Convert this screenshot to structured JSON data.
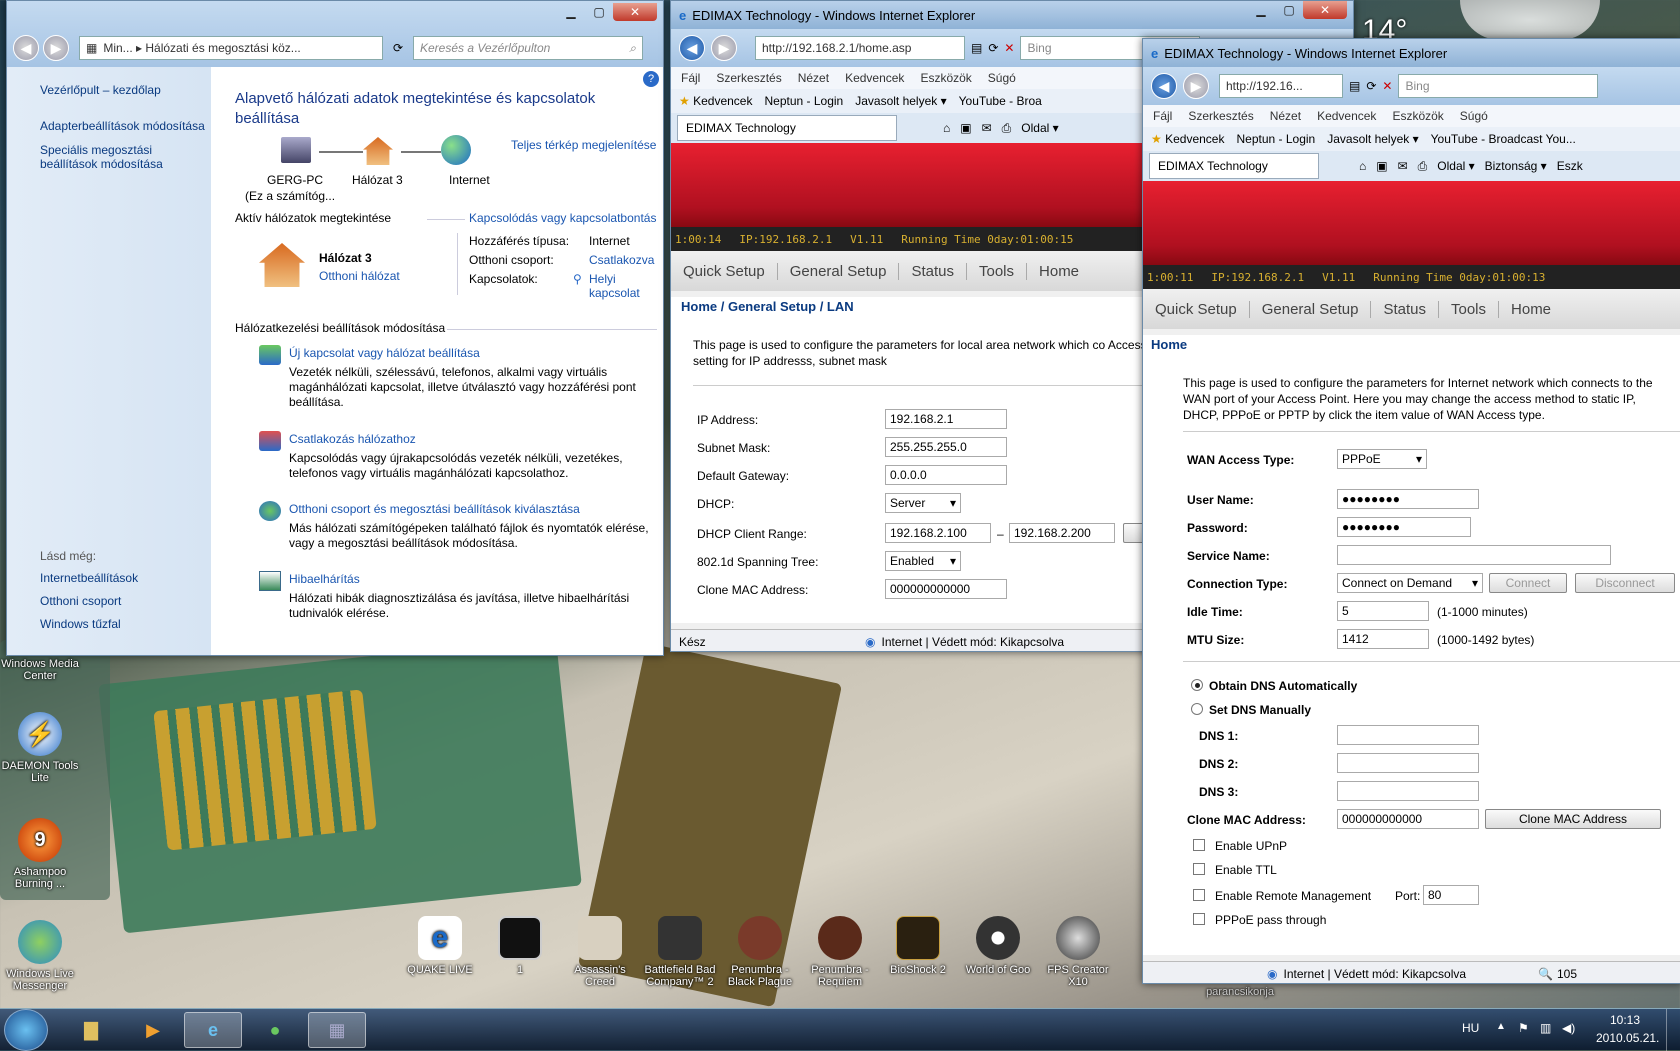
{
  "desktop": {
    "icons": [
      {
        "label": "Windows Media Center"
      },
      {
        "label": "DAEMON Tools Lite"
      },
      {
        "label": "Ashampoo Burning ..."
      },
      {
        "label": "Windows Live Messenger"
      },
      {
        "label": "QUAKE LIVE"
      },
      {
        "label": "1"
      },
      {
        "label": "Assassin's Creed"
      },
      {
        "label": "Battlefield Bad Company™ 2"
      },
      {
        "label": "Penumbra - Black Plague"
      },
      {
        "label": "Penumbra - Requiem"
      },
      {
        "label": "BioShock 2"
      },
      {
        "label": "World of Goo"
      },
      {
        "label": "FPS Creator X10"
      }
    ],
    "overlay_text": "parancsikonja",
    "gadget_temp": "14°"
  },
  "cp": {
    "address": "Min... ▸ Hálózati és megosztási köz...",
    "search_placeholder": "Keresés a Vezérlőpulton",
    "sidebar": {
      "home": "Vezérlőpult – kezdőlap",
      "items": [
        "Adapterbeállítások módosítása",
        "Speciális megosztási beállítások módosítása"
      ],
      "see_also_title": "Lásd még:",
      "see_also": [
        "Internetbeállítások",
        "Otthoni csoport",
        "Windows tűzfal"
      ]
    },
    "title": "Alapvető hálózati adatok megtekintése és kapcsolatok beállítása",
    "map_link": "Teljes térkép megjelenítése",
    "map": {
      "pc": "GERG-PC",
      "pc_sub": "(Ez a számítóg...",
      "network": "Hálózat 3",
      "internet": "Internet"
    },
    "active_title": "Aktív hálózatok megtekintése",
    "connect_link": "Kapcsolódás vagy kapcsolatbontás",
    "active": {
      "name": "Hálózat  3",
      "type_link": "Otthoni hálózat",
      "access_label": "Hozzáférés típusa:",
      "access_value": "Internet",
      "homegroup_label": "Otthoni csoport:",
      "homegroup_value": "Csatlakozva",
      "connections_label": "Kapcsolatok:",
      "connections_value": "Helyi kapcsolat"
    },
    "settings_title": "Hálózatkezelési beállítások módosítása",
    "tasks": [
      {
        "title": "Új kapcsolat vagy hálózat beállítása",
        "desc": "Vezeték nélküli, szélessávú, telefonos, alkalmi vagy virtuális magánhálózati kapcsolat, illetve útválasztó vagy hozzáférési pont beállítása."
      },
      {
        "title": "Csatlakozás hálózathoz",
        "desc": "Kapcsolódás vagy újrakapcsolódás vezeték nélküli, vezetékes, telefonos vagy virtuális magánhálózati kapcsolathoz."
      },
      {
        "title": "Otthoni csoport és megosztási beállítások kiválasztása",
        "desc": "Más hálózati számítógépeken található fájlok és nyomtatók elérése, vagy a megosztási beállítások módosítása."
      },
      {
        "title": "Hibaelhárítás",
        "desc": "Hálózati hibák diagnosztizálása és javítása, illetve hibaelhárítási tudnivalók elérése."
      }
    ]
  },
  "ie1": {
    "title": "EDIMAX Technology - Windows Internet Explorer",
    "url": "http://192.168.2.1/home.asp",
    "search": "Bing",
    "menu": [
      "Fájl",
      "Szerkesztés",
      "Nézet",
      "Kedvencek",
      "Eszközök",
      "Súgó"
    ],
    "fav": [
      "Kedvencek",
      "Neptun - Login",
      "Javasolt helyek ▾",
      "YouTube - Broa"
    ],
    "tab": "EDIMAX Technology",
    "cmd": "Oldal ▾",
    "strip": [
      "1:00:14",
      "IP:192.168.2.1",
      "V1.11",
      "Running Time 0day:01:00:15"
    ],
    "nav": [
      "Quick Setup",
      "General Setup",
      "Status",
      "Tools",
      "Home"
    ],
    "breadcrumb": "Home / General Setup / LAN",
    "desc": "This page is used to configure the parameters for local area network which co Access Point. Here you may change the setting for IP addresss, subnet mask",
    "fields": [
      {
        "label": "IP Address:",
        "value": "192.168.2.1"
      },
      {
        "label": "Subnet Mask:",
        "value": "255.255.255.0"
      },
      {
        "label": "Default Gateway:",
        "value": "0.0.0.0"
      },
      {
        "label": "DHCP:",
        "value": "Server"
      },
      {
        "label": "DHCP Client Range:",
        "value": "192.168.2.100",
        "value2": "192.168.2.200",
        "sep": "–"
      },
      {
        "label": "802.1d Spanning Tree:",
        "value": "Enabled"
      },
      {
        "label": "Clone MAC Address:",
        "value": "000000000000"
      }
    ],
    "status_left": "Kész",
    "status_zone": "Internet | Védett mód: Kikapcsolva"
  },
  "ie2": {
    "title": "EDIMAX Technology - Windows Internet Explorer",
    "url": "http://192.16...",
    "search": "Bing",
    "menu": [
      "Fájl",
      "Szerkesztés",
      "Nézet",
      "Kedvencek",
      "Eszközök",
      "Súgó"
    ],
    "fav": [
      "Kedvencek",
      "Neptun - Login",
      "Javasolt helyek ▾",
      "YouTube - Broadcast You..."
    ],
    "tab": "EDIMAX Technology",
    "cmd": [
      "Oldal ▾",
      "Biztonság ▾",
      "Eszk"
    ],
    "strip": [
      "1:00:11",
      "IP:192.168.2.1",
      "V1.11",
      "Running Time 0day:01:00:13"
    ],
    "nav": [
      "Quick Setup",
      "General Setup",
      "Status",
      "Tools",
      "Home"
    ],
    "breadcrumb": "Home",
    "desc": "This page is used to configure the parameters for Internet network which connects to the WAN port of your Access Point. Here you may change the access method to static IP, DHCP, PPPoE or PPTP by click the item value of WAN Access type.",
    "wan_label": "WAN Access Type:",
    "wan_value": "PPPoE",
    "user_label": "User Name:",
    "user_value": "●●●●●●●●",
    "pass_label": "Password:",
    "pass_value": "●●●●●●●●",
    "service_label": "Service Name:",
    "conn_label": "Connection Type:",
    "conn_value": "Connect on Demand",
    "connect_btn": "Connect",
    "disconnect_btn": "Disconnect",
    "idle_label": "Idle Time:",
    "idle_value": "5",
    "idle_unit": "(1-1000 minutes)",
    "mtu_label": "MTU Size:",
    "mtu_value": "1412",
    "mtu_unit": "(1000-1492 bytes)",
    "dns_auto": "Obtain DNS Automatically",
    "dns_manual": "Set DNS Manually",
    "dns1": "DNS 1:",
    "dns2": "DNS 2:",
    "dns3": "DNS 3:",
    "clone_label": "Clone MAC Address:",
    "clone_value": "000000000000",
    "clone_btn": "Clone MAC Address",
    "upnp": "Enable UPnP",
    "ttl": "Enable TTL",
    "remote": "Enable Remote Management",
    "port_label": "Port:",
    "port_value": "80",
    "pppoe_pass": "PPPoE pass through",
    "status_zone": "Internet | Védett mód: Kikapcsolva",
    "zoom": "105"
  },
  "taskbar": {
    "lang": "HU",
    "time": "10:13",
    "date": "2010.05.21."
  },
  "colors": {
    "accent": "#1a56b0",
    "banner": "#c81020",
    "strip_text": "#d8b030"
  }
}
